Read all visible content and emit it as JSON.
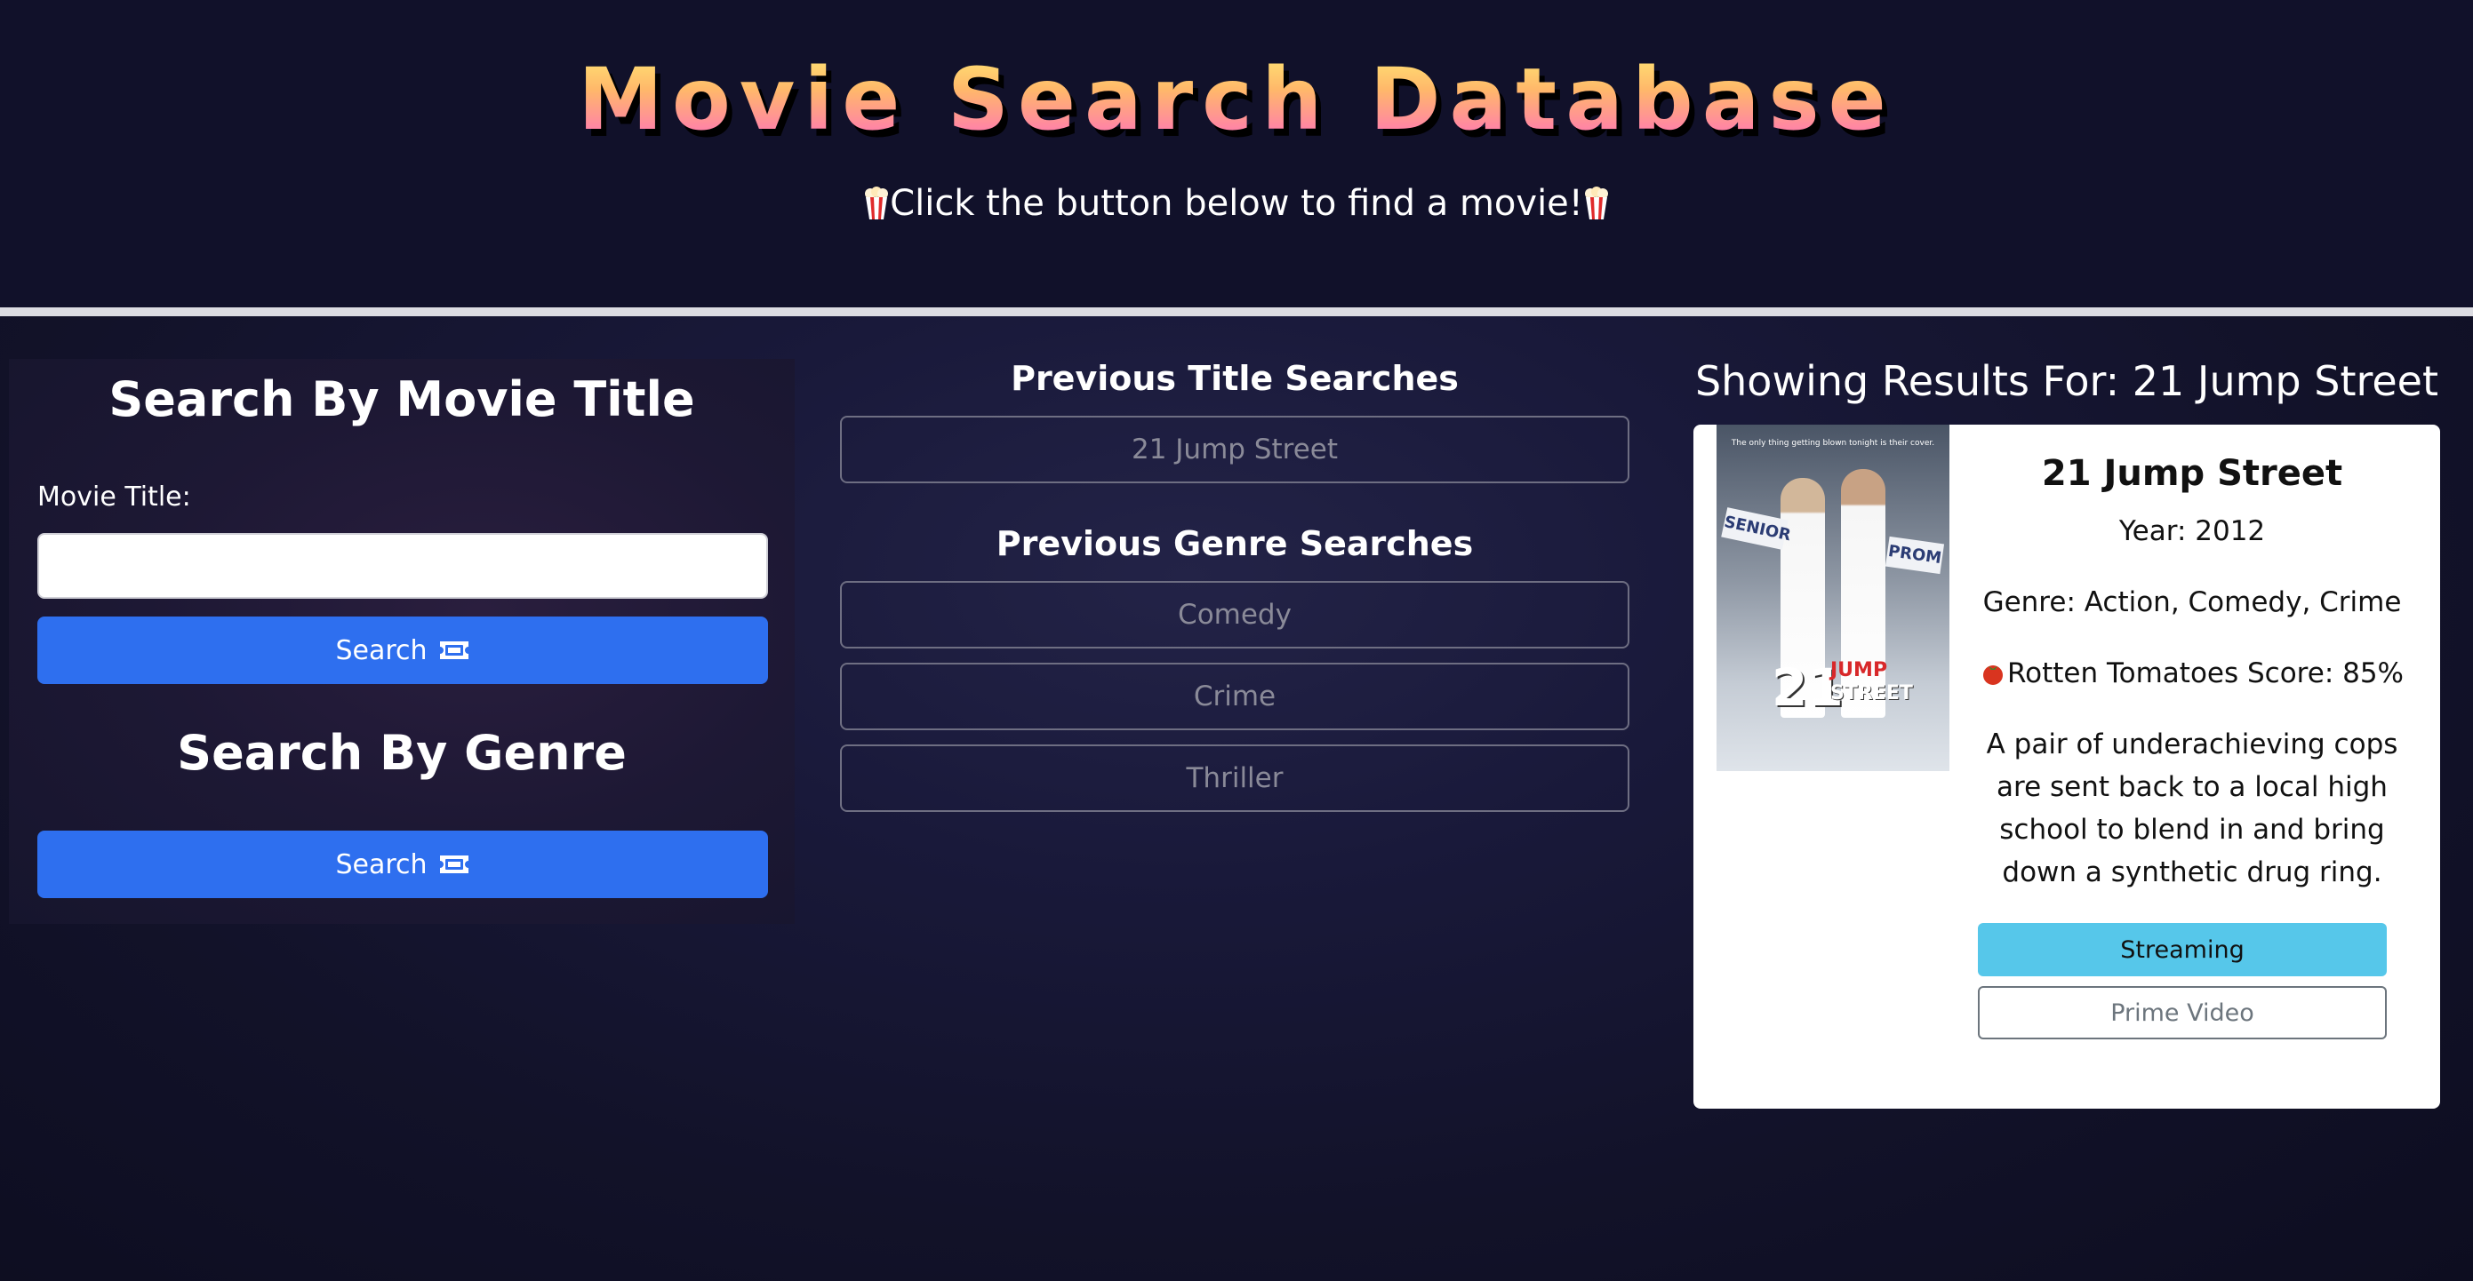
{
  "header": {
    "title": "Movie Search Database",
    "subtitle": "Click the button below to find a movie!",
    "subtitle_icon": "popcorn-icon"
  },
  "title_search": {
    "heading": "Search By Movie Title",
    "field_label": "Movie Title:",
    "input_value": "",
    "button_label": "Search",
    "button_icon": "ticket-icon"
  },
  "genre_search": {
    "heading": "Search By Genre",
    "button_label": "Search",
    "button_icon": "ticket-icon"
  },
  "history": {
    "title_heading": "Previous Title Searches",
    "titles": [
      "21 Jump Street"
    ],
    "genre_heading": "Previous Genre Searches",
    "genres": [
      "Comedy",
      "Crime",
      "Thriller"
    ]
  },
  "results": {
    "heading": "Showing Results For: 21 Jump Street",
    "movie": {
      "title": "21 Jump Street",
      "year": "Year: 2012",
      "genre": "Genre: Action, Comedy, Crime",
      "rating": "Rotten Tomatoes Score: 85%",
      "rating_icon": "tomato-icon",
      "plot_lines": [
        "A pair of underachieving cops",
        "are sent back to a local high",
        "school to blend in and bring",
        "down a synthetic drug ring."
      ],
      "streaming_label": "Streaming",
      "provider": "Prime Video",
      "poster": {
        "tagline": "The only thing getting blown tonight is their cover.",
        "sign_left": "SENIOR",
        "sign_right": "PROM",
        "logo_number": "21",
        "logo_word1": "JUMP",
        "logo_word2": "STREET"
      }
    }
  },
  "colors": {
    "background": "#111128",
    "primary_button": "#2e6fef",
    "streaming_badge": "#56c7ea",
    "divider": "#dcdce2"
  }
}
